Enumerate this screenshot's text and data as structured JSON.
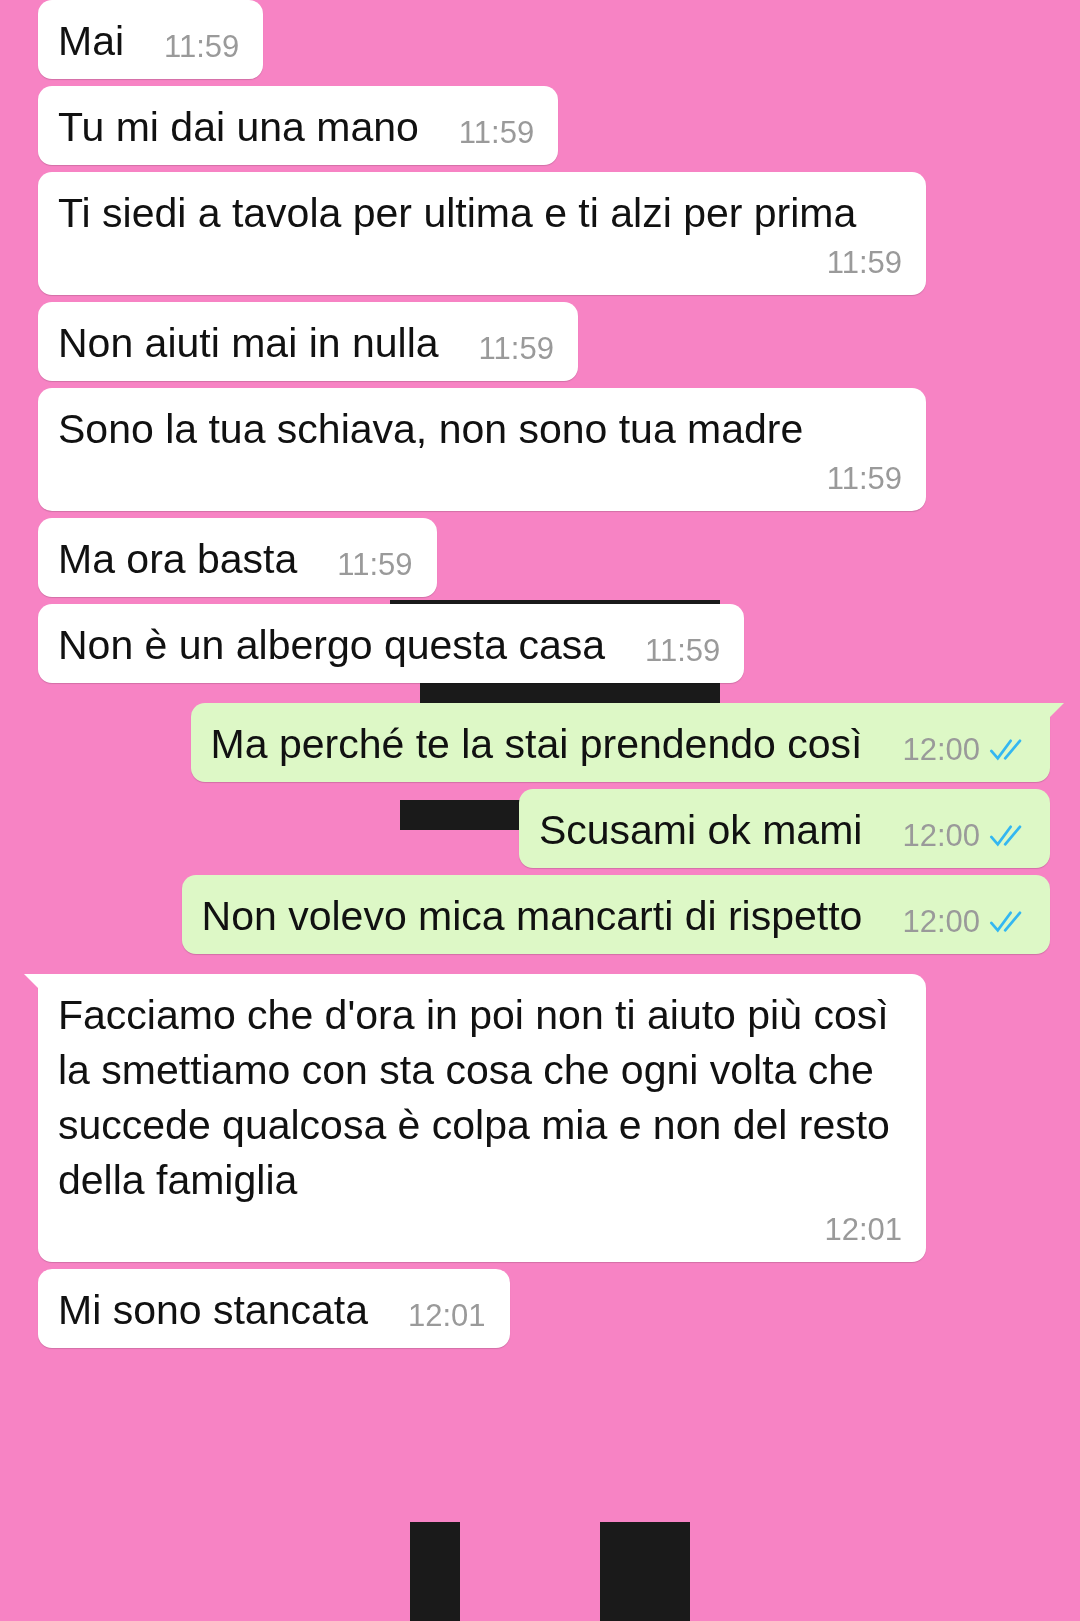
{
  "messages": [
    {
      "kind": "in",
      "text": "Mai",
      "time": "11:59",
      "tail": false
    },
    {
      "kind": "in",
      "text": "Tu mi dai una mano",
      "time": "11:59",
      "tail": false
    },
    {
      "kind": "in",
      "text": "Ti siedi a tavola per ultima e ti alzi per prima",
      "time": "11:59",
      "tail": false
    },
    {
      "kind": "in",
      "text": "Non aiuti mai in nulla",
      "time": "11:59",
      "tail": false
    },
    {
      "kind": "in",
      "text": "Sono la tua schiava, non sono tua madre",
      "time": "11:59",
      "tail": false
    },
    {
      "kind": "in",
      "text": "Ma ora basta",
      "time": "11:59",
      "tail": false
    },
    {
      "kind": "in",
      "text": "Non è un albergo questa casa",
      "time": "11:59",
      "tail": false
    },
    {
      "kind": "out",
      "text": "Ma perché te la stai prendendo così",
      "time": "12:00",
      "tail": true,
      "read": true
    },
    {
      "kind": "out",
      "text": "Scusami ok mami",
      "time": "12:00",
      "tail": false,
      "read": true
    },
    {
      "kind": "out",
      "text": "Non volevo mica mancarti di rispetto",
      "time": "12:00",
      "tail": false,
      "read": true
    },
    {
      "kind": "in",
      "text": "Facciamo che d'ora in poi non ti aiuto più così la smettiamo con sta cosa che ogni volta che succede qualcosa è colpa mia e non del resto della famiglia",
      "time": "12:01",
      "tail": true
    },
    {
      "kind": "in",
      "text": "Mi sono stancata",
      "time": "12:01",
      "tail": false
    }
  ]
}
